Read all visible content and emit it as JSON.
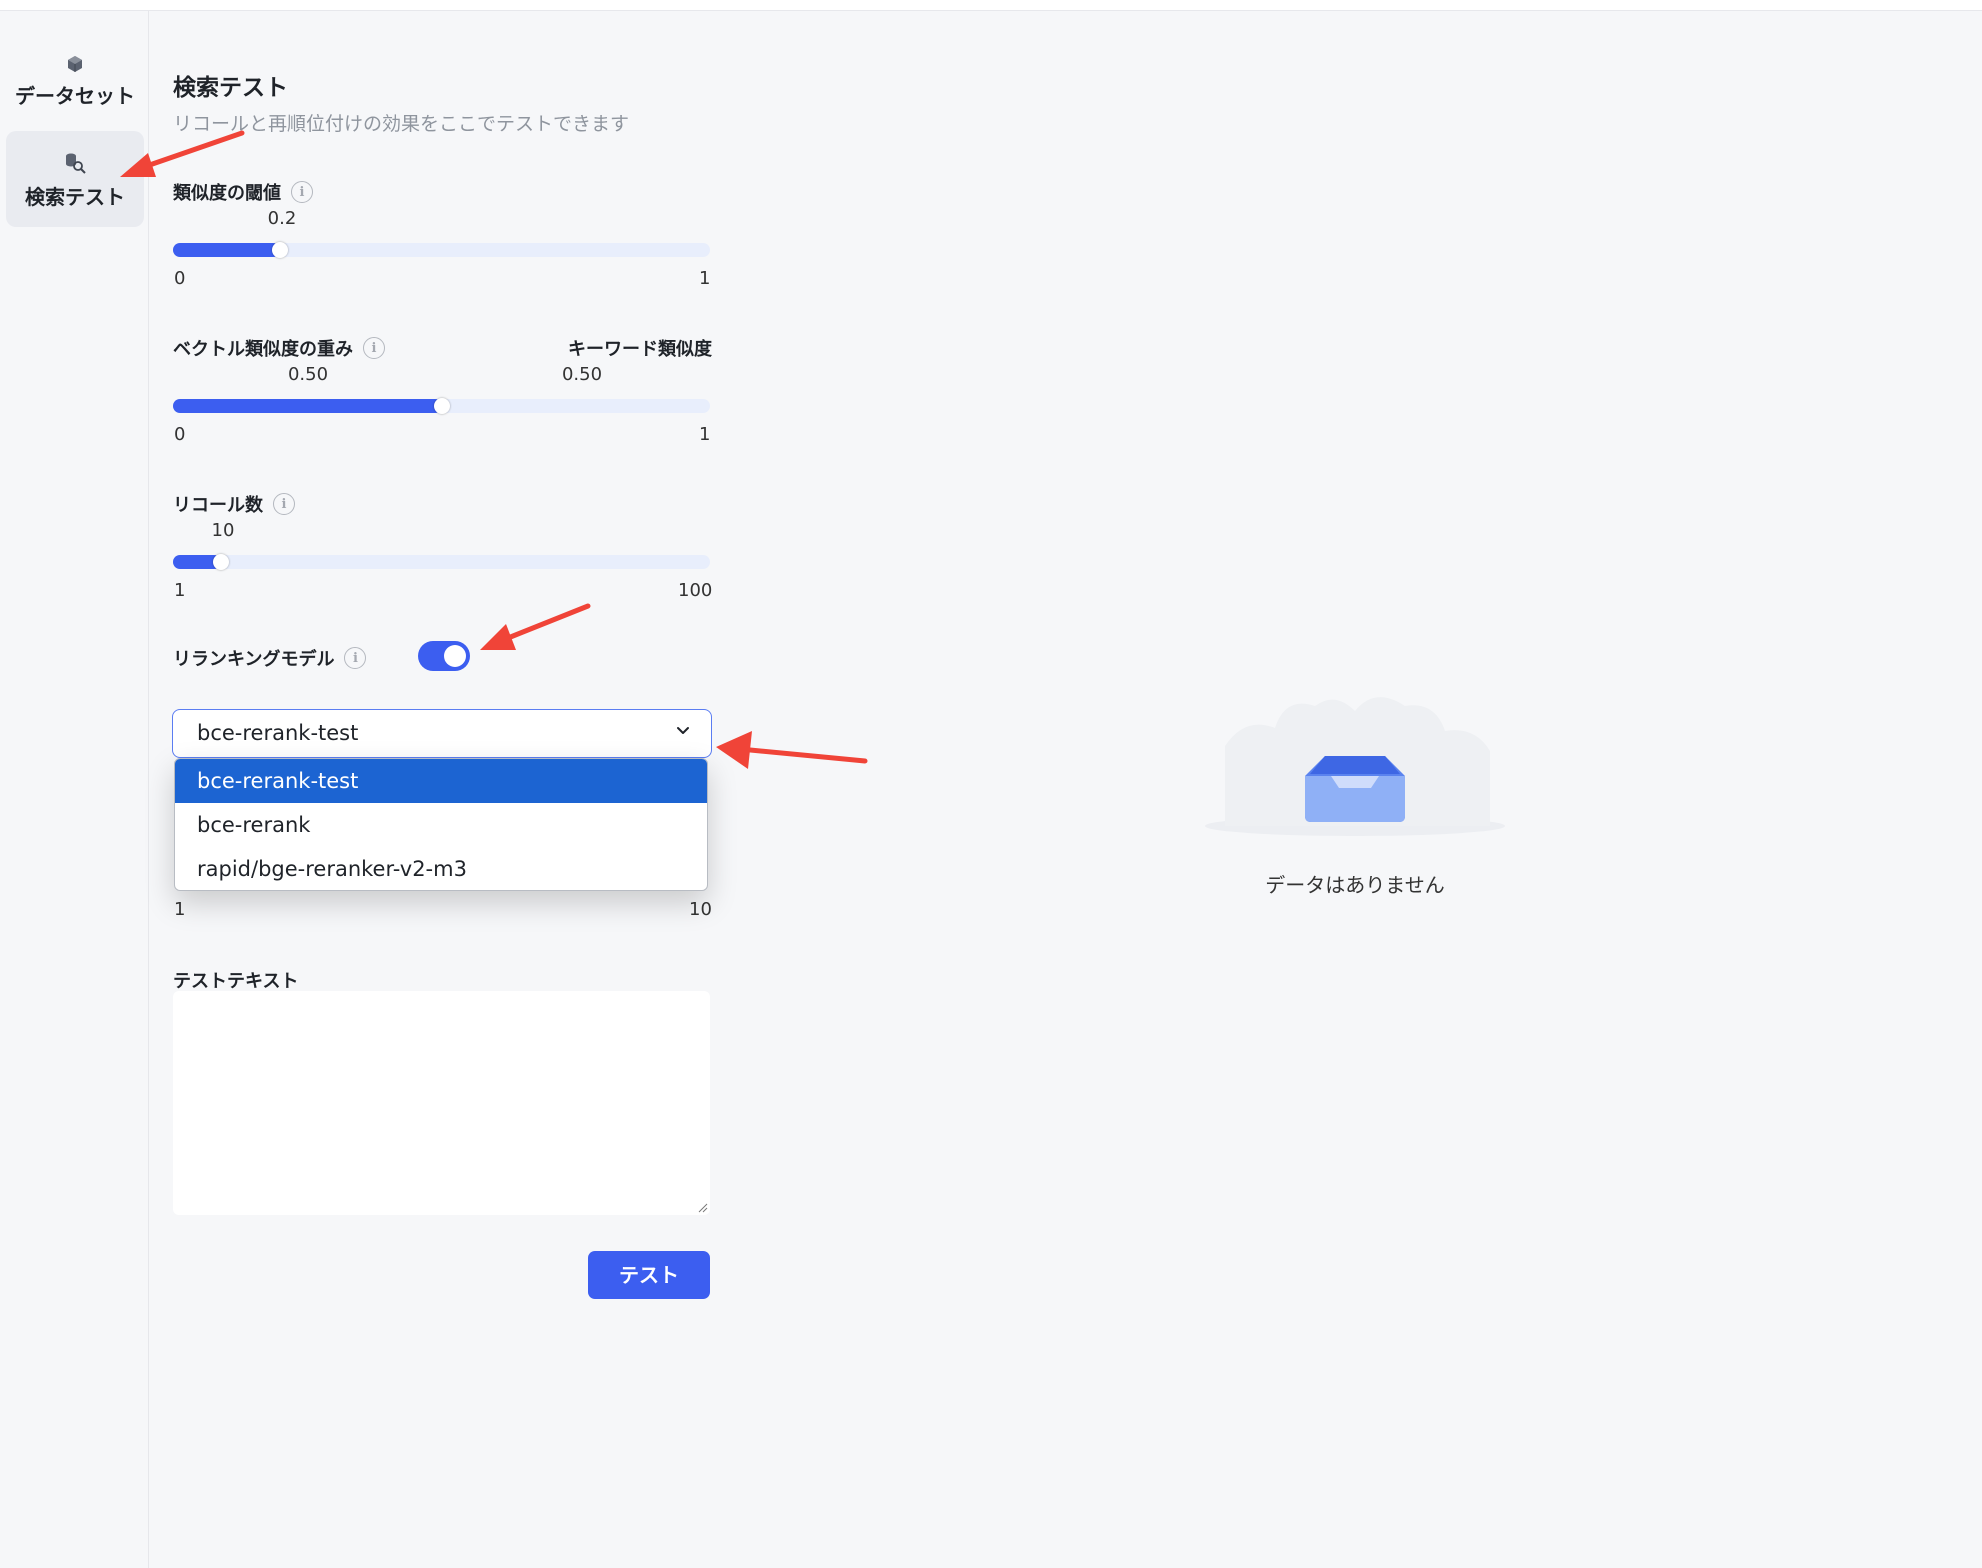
{
  "nav": {
    "items": [
      {
        "label": "データセット",
        "icon": "cube-icon",
        "active": false
      },
      {
        "label": "検索テスト",
        "icon": "search-data-icon",
        "active": true
      }
    ]
  },
  "panel": {
    "title": "検索テスト",
    "subtitle": "リコールと再順位付けの効果をここでテストできます",
    "similarity_threshold": {
      "label": "類似度の閾値",
      "value": "0.2",
      "min": "0",
      "max": "1",
      "fraction": 0.2
    },
    "vector_weight": {
      "label": "ベクトル類似度の重み",
      "right_label": "キーワード類似度",
      "value": "0.50",
      "right_value": "0.50",
      "min": "0",
      "max": "1",
      "fraction": 0.5
    },
    "recall_count": {
      "label": "リコール数",
      "value": "10",
      "min": "1",
      "max": "100",
      "fraction": 0.09
    },
    "rerank": {
      "label": "リランキングモデル",
      "enabled": true
    },
    "rerank_select": {
      "selected": "bce-rerank-test",
      "options": [
        "bce-rerank-test",
        "bce-rerank",
        "rapid/bge-reranker-v2-m3"
      ]
    },
    "hidden_slider": {
      "min": "1",
      "max": "10"
    },
    "test_text": {
      "label": "テストテキスト",
      "value": ""
    },
    "test_button": "テスト"
  },
  "result": {
    "empty_text": "データはありません"
  },
  "colors": {
    "accent": "#3c5ef0",
    "dropdown_selected": "#1c64d2",
    "annotation_arrow": "#f04438"
  }
}
